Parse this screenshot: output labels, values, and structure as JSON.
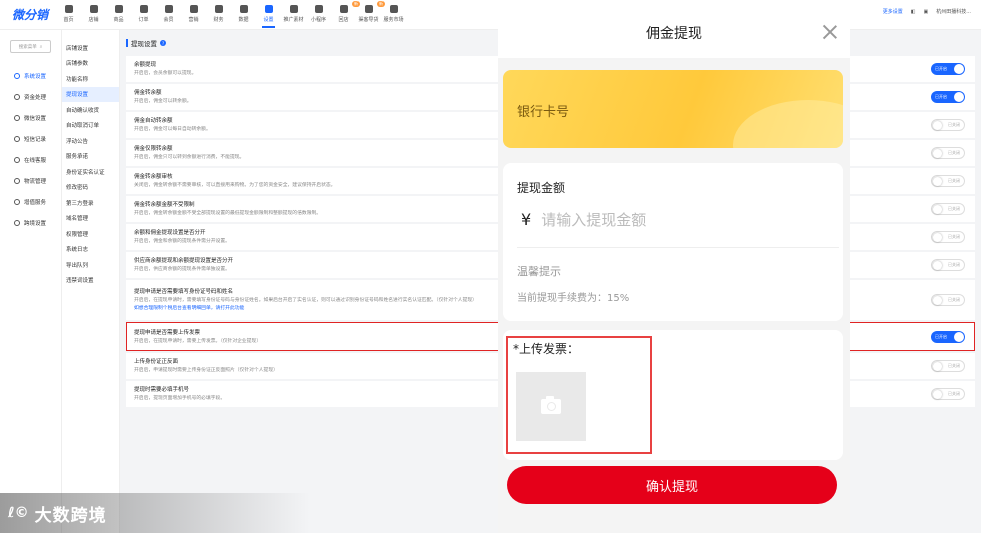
{
  "brand": {
    "logo": "微分销"
  },
  "nav": [
    {
      "label": "首页"
    },
    {
      "label": "店铺"
    },
    {
      "label": "商品"
    },
    {
      "label": "订单"
    },
    {
      "label": "会员"
    },
    {
      "label": "营销"
    },
    {
      "label": "财务"
    },
    {
      "label": "数据"
    },
    {
      "label": "设置",
      "active": true
    },
    {
      "label": "推广素材"
    },
    {
      "label": "小程序"
    },
    {
      "label": "回店",
      "badge": "新"
    },
    {
      "label": "渠客导货",
      "badge": "新"
    },
    {
      "label": "服务市场"
    }
  ],
  "topright": {
    "link": "更多设置",
    "shop": "杭州田播科技..."
  },
  "sidebar": {
    "search_placeholder": "搜索菜单",
    "items": [
      {
        "label": "系统设置",
        "active": true
      },
      {
        "label": "资金处理"
      },
      {
        "label": "微信设置"
      },
      {
        "label": "短信记录"
      },
      {
        "label": "在线客服"
      },
      {
        "label": "物流管理"
      },
      {
        "label": "增值服务"
      },
      {
        "label": "跨境设置"
      }
    ]
  },
  "submenu": [
    {
      "label": "店铺设置"
    },
    {
      "label": "店铺参数"
    },
    {
      "label": "功能名称"
    },
    {
      "label": "提现设置",
      "active": true
    },
    {
      "label": "自动确认收货"
    },
    {
      "label": "自动取消订单"
    },
    {
      "label": "浮动公告"
    },
    {
      "label": "服务承诺"
    },
    {
      "label": "身份证实名认证"
    },
    {
      "label": "修改密码"
    },
    {
      "label": "第三方登录"
    },
    {
      "label": "域名管理"
    },
    {
      "label": "权限管理"
    },
    {
      "label": "系统日志"
    },
    {
      "label": "导出队列"
    },
    {
      "label": "违禁词设置"
    }
  ],
  "panel": {
    "title": "提现设置",
    "toggle_on": "已开启",
    "toggle_off": "已关闭",
    "rows": [
      {
        "title": "余额提现",
        "desc": "开启后，会员余额可以提现。",
        "on": true,
        "h": 26
      },
      {
        "title": "佣金转余额",
        "desc": "开启后，佣金可以转余额。",
        "on": true,
        "h": 26
      },
      {
        "title": "佣金自动转余额",
        "desc": "开启后，佣金可以每日自动转余额。",
        "on": false,
        "h": 26
      },
      {
        "title": "佣金仅限转余额",
        "desc": "开启后，佣金只可以转到余额进行消费，不能提现。",
        "on": false,
        "h": 26
      },
      {
        "title": "佣金转余额审核",
        "desc": "关闭后，佣金转余额不需要审核，可以直接用来购物。为了您的资金安全，建议保持开启状态。",
        "on": false,
        "h": 26
      },
      {
        "title": "佣金转余额金额不受限制",
        "desc": "开启后，佣金转余额金额不受全部提现设置的最低提现金额限制和整额提现的倍数限制。",
        "on": false,
        "h": 26
      },
      {
        "title": "余额和佣金提现设置是否分开",
        "desc": "开启后，佣金和余额的提现条件需分开设置。",
        "on": false,
        "h": 26
      },
      {
        "title": "供应商余额提现和余额提现设置是否分开",
        "desc": "开启后，供应商余额的提现条件需单独设置。",
        "on": false,
        "h": 26
      },
      {
        "title": "提现申请是否需要填写身份证号码和姓名",
        "desc": "开启后，在提现申请时，需要填写身份证号码与身份证姓名。如果后台开启了实名认证，则可以通过识别身份证号码和姓名进行实名认证匹配。（仅针对个人提现）",
        "link": "如想合理限制个税后台查看明细回单，请打开此功能",
        "on": false,
        "h": 40
      },
      {
        "title": "提现申请是否需要上传发票",
        "desc": "开启后，在提现申请时，需要上传发票。（仅针对企业提现）",
        "on": true,
        "h": 29,
        "highlight": true
      },
      {
        "title": "上传身份证正反面",
        "desc": "开启后，申请提现时需要上传身份证正反面照片（仅针对个人提现）",
        "on": false,
        "h": 26
      },
      {
        "title": "提现时需要必填手机号",
        "desc": "开启后，提现页面增加手机号的必填字段。",
        "on": false,
        "h": 26
      }
    ]
  },
  "modal": {
    "title": "佣金提现",
    "card_label": "银行卡号",
    "amount_label": "提现金额",
    "currency": "¥",
    "amount_placeholder": "请输入提现金额",
    "tip_title": "温馨提示",
    "tip_text": "当前提现手续费为：15%",
    "upload_label": "*上传发票：",
    "confirm_label": "确认提现"
  },
  "watermark": {
    "logo": "ℓ©",
    "text": "大数跨境"
  },
  "colors": {
    "accent": "#1a66ff",
    "danger": "#e50019",
    "card": "#ffd04a"
  }
}
